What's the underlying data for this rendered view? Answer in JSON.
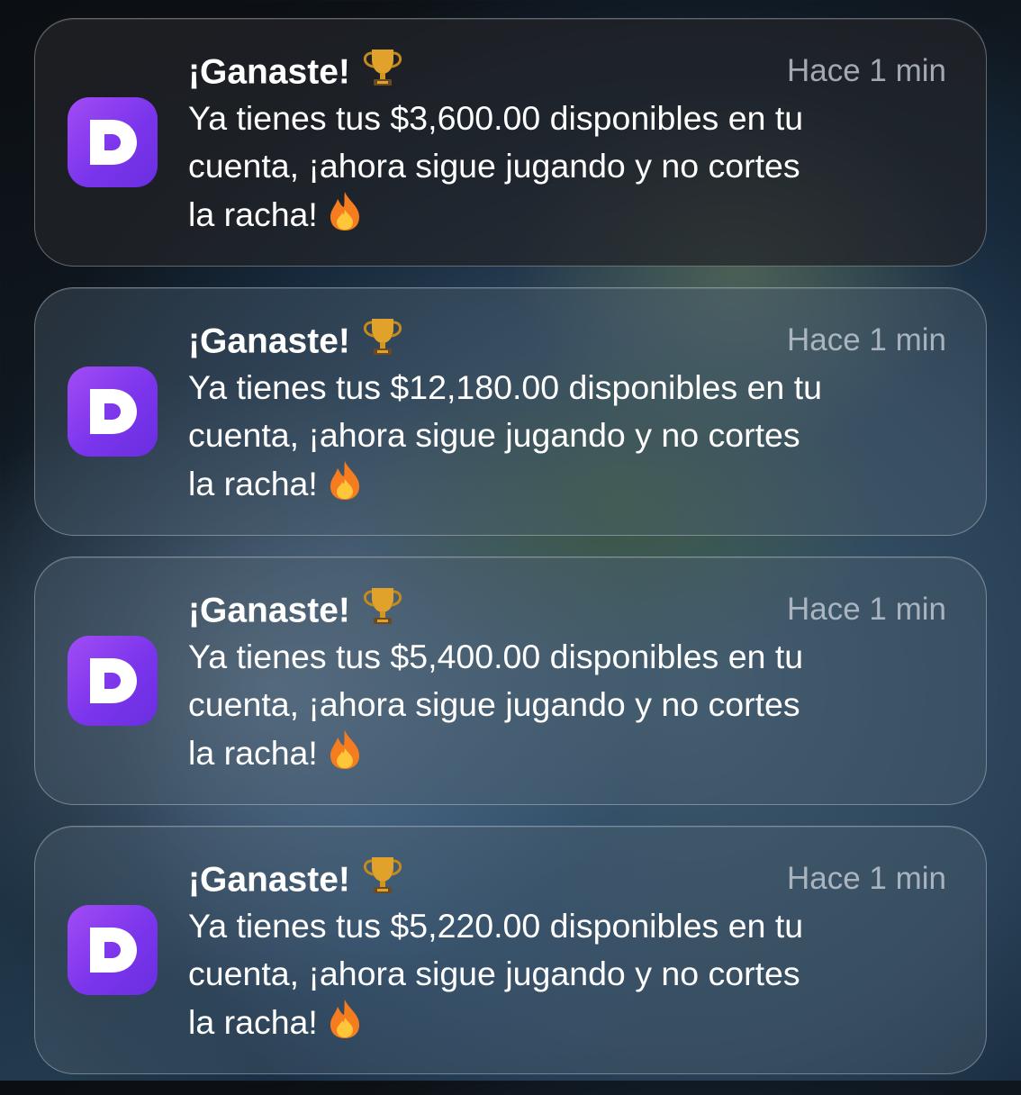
{
  "notifications": [
    {
      "title": "¡Ganaste!",
      "title_emoji": "trophy-icon",
      "time": "Hace 1 min",
      "lines": [
        "Ya tienes tus $3,600.00 disponibles en tu",
        "cuenta, ¡ahora sigue jugando y no cortes",
        "la racha!"
      ],
      "end_emoji": "fire-icon"
    },
    {
      "title": "¡Ganaste!",
      "title_emoji": "trophy-icon",
      "time": "Hace 1 min",
      "lines": [
        "Ya tienes tus $12,180.00 disponibles en tu",
        "cuenta, ¡ahora sigue jugando y no cortes",
        "la racha!"
      ],
      "end_emoji": "fire-icon"
    },
    {
      "title": "¡Ganaste!",
      "title_emoji": "trophy-icon",
      "time": "Hace 1 min",
      "lines": [
        "Ya tienes tus $5,400.00 disponibles en tu",
        "cuenta, ¡ahora sigue jugando y no cortes",
        "la racha!"
      ],
      "end_emoji": "fire-icon"
    },
    {
      "title": "¡Ganaste!",
      "title_emoji": "trophy-icon",
      "time": "Hace 1 min",
      "lines": [
        "Ya tienes tus $5,220.00 disponibles en tu",
        "cuenta, ¡ahora sigue jugando y no cortes",
        "la racha!"
      ],
      "end_emoji": "fire-icon"
    }
  ],
  "colors": {
    "app_icon_top": "#a24cf5",
    "app_icon_bottom": "#6a2ee0",
    "trophy_gold": "#e0a22a",
    "fire_orange": "#f57c1f"
  }
}
